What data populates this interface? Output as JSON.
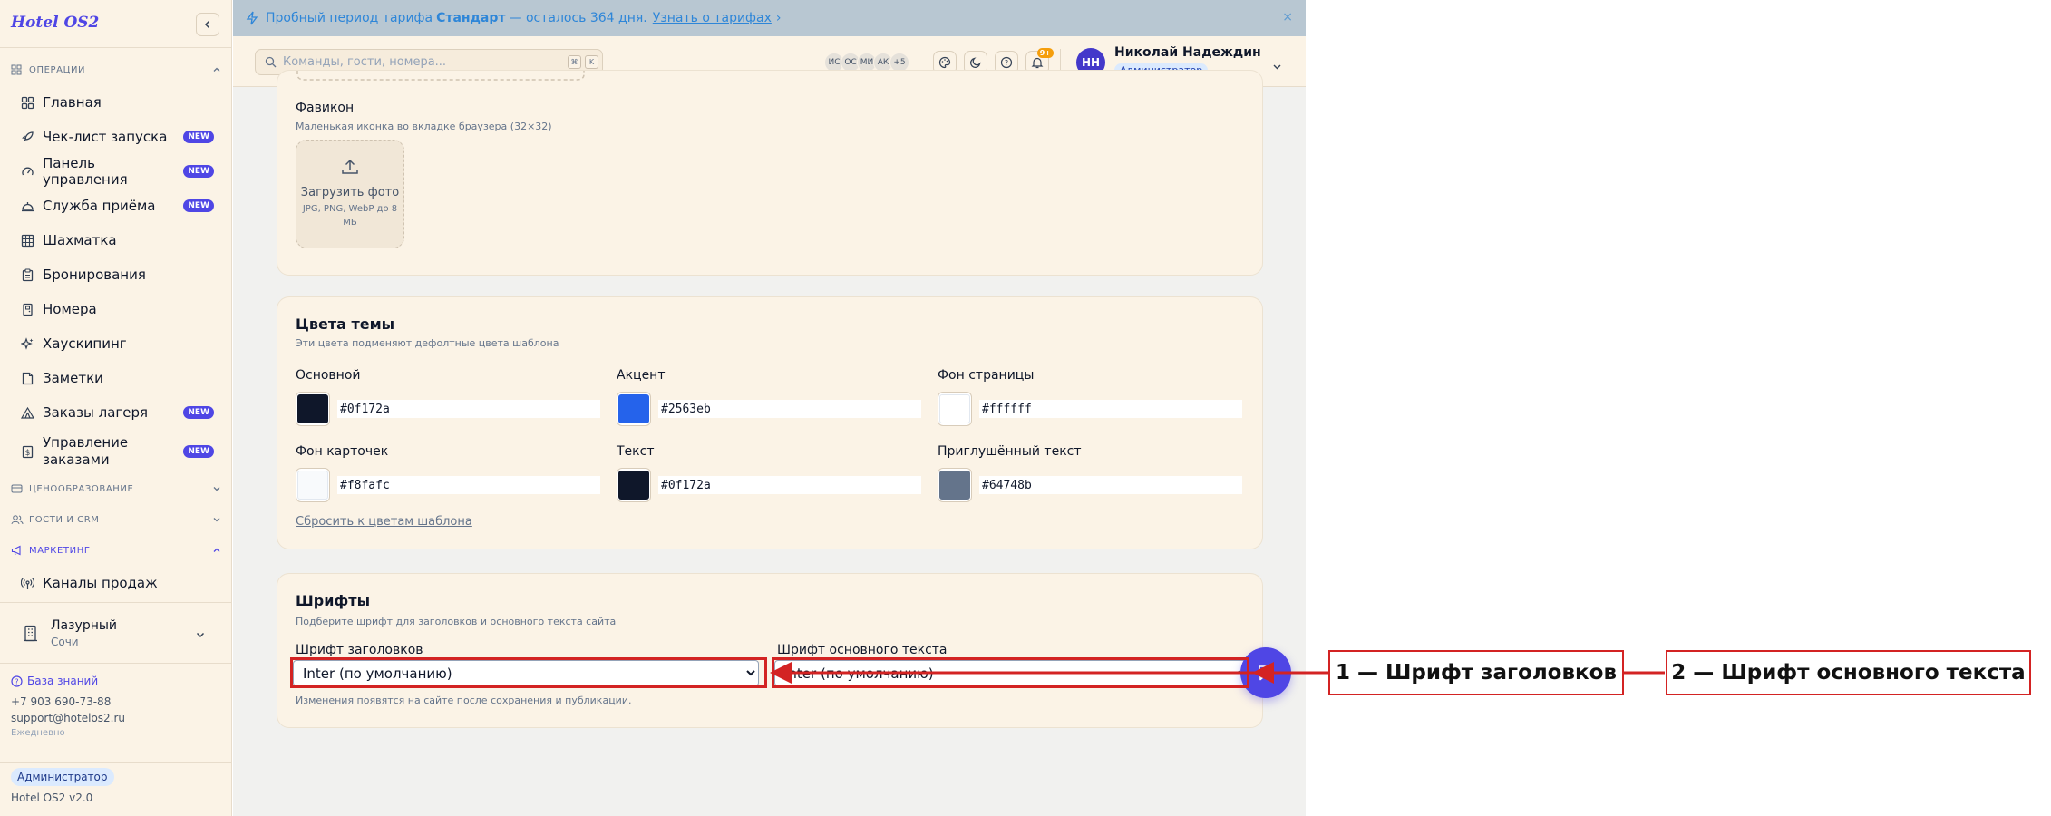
{
  "colors": {
    "accent": "#4f46e5",
    "annotation": "#d32323",
    "sidebar_bg": "#fbf3e6",
    "trial_bg": "#b8c7d2"
  },
  "sidebar": {
    "brand": "Hotel OS2",
    "sections": {
      "operations": "ОПЕРАЦИИ",
      "pricing": "ЦЕНООБРАЗОВАНИЕ",
      "guests": "ГОСТИ И CRM",
      "marketing": "МАРКЕТИНГ"
    },
    "items": [
      {
        "label": "Главная",
        "icon": "dashboard-icon"
      },
      {
        "label": "Чек-лист запуска",
        "icon": "rocket-icon",
        "badge": "NEW"
      },
      {
        "label": "Панель управления",
        "icon": "gauge-icon",
        "badge": "NEW"
      },
      {
        "label": "Служба приёма",
        "icon": "bell-desk-icon",
        "badge": "NEW"
      },
      {
        "label": "Шахматка",
        "icon": "grid-icon"
      },
      {
        "label": "Бронирования",
        "icon": "clipboard-icon"
      },
      {
        "label": "Номера",
        "icon": "door-icon"
      },
      {
        "label": "Хаускипинг",
        "icon": "sparkles-icon"
      },
      {
        "label": "Заметки",
        "icon": "note-icon"
      },
      {
        "label": "Заказы лагеря",
        "icon": "tent-icon",
        "badge": "NEW"
      },
      {
        "label": "Управление заказами",
        "icon": "receipt-icon",
        "badge": "NEW"
      }
    ],
    "marketing_items": [
      {
        "label": "Каналы продаж",
        "icon": "radio-icon"
      }
    ],
    "hotel": {
      "name": "Лазурный",
      "city": "Сочи"
    },
    "support": {
      "kb": "База знаний",
      "phone": "+7 903 690-73-88",
      "email": "support@hotelos2.ru",
      "schedule": "Ежедневно"
    },
    "role": "Администратор",
    "version": "Hotel OS2 v2.0"
  },
  "trial": {
    "prefix": "Пробный период тарифа",
    "plan": "Стандарт",
    "remaining": "— осталось 364 дня.",
    "link": "Узнать о тарифах",
    "link_arrow": "›",
    "close": "×"
  },
  "topbar": {
    "search_placeholder": "Команды, гости, номера...",
    "kbd_cmd": "⌘",
    "kbd_k": "K",
    "presence": [
      "ИС",
      "ОС",
      "МИ",
      "АК"
    ],
    "presence_more": "+5",
    "notif_count": "9+",
    "user": {
      "initials": "НН",
      "name": "Николай Надеждин",
      "role": "Администратор"
    }
  },
  "favicon": {
    "title": "Фавикон",
    "subtitle": "Маленькая иконка во вкладке браузера (32×32)",
    "upload_label": "Загрузить фото",
    "upload_hint": "JPG, PNG, WebP до 8 МБ"
  },
  "theme": {
    "title": "Цвета темы",
    "subtitle": "Эти цвета подменяют дефолтные цвета шаблона",
    "fields": [
      {
        "label": "Основной",
        "value": "#0f172a"
      },
      {
        "label": "Акцент",
        "value": "#2563eb"
      },
      {
        "label": "Фон страницы",
        "value": "#ffffff"
      },
      {
        "label": "Фон карточек",
        "value": "#f8fafc"
      },
      {
        "label": "Текст",
        "value": "#0f172a"
      },
      {
        "label": "Приглушённый текст",
        "value": "#64748b"
      }
    ],
    "reset": "Сбросить к цветам шаблона"
  },
  "fonts": {
    "title": "Шрифты",
    "subtitle": "Подберите шрифт для заголовков и основного текста сайта",
    "heading_label": "Шрифт заголовков",
    "heading_value": "Inter (по умолчанию)",
    "body_label": "Шрифт основного текста",
    "body_value": "Inter (по умолчанию)",
    "note": "Изменения появятся на сайте после сохранения и публикации."
  },
  "annotations": [
    {
      "label": "1 — Шрифт заголовков"
    },
    {
      "label": "2 — Шрифт основного текста"
    }
  ]
}
